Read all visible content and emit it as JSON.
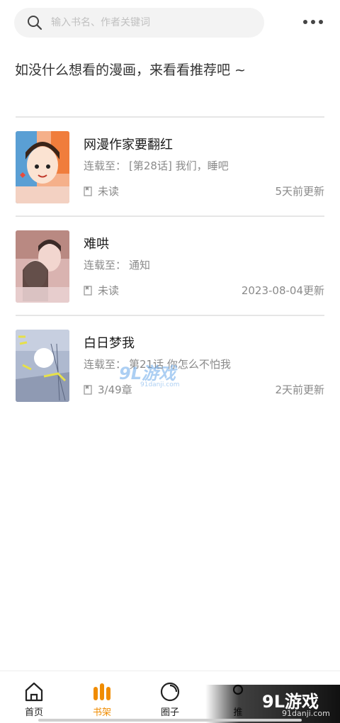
{
  "search": {
    "placeholder": "输入书名、作者关键词",
    "icon": "search-icon"
  },
  "header": {
    "more_icon": "more-dots-icon"
  },
  "prompt": "如没什么想看的漫画，来看看推荐吧 ~",
  "books": [
    {
      "title": "网漫作家要翻红",
      "update_prefix": "连载至：",
      "update_text": "[第28话] 我们，睡吧",
      "read_status": "未读",
      "updated_time": "5天前更新"
    },
    {
      "title": "难哄",
      "update_prefix": "连载至：",
      "update_text": "通知",
      "read_status": "未读",
      "updated_time": "2023-08-04更新"
    },
    {
      "title": "白日梦我",
      "update_prefix": "连载至：",
      "update_text": "第21话 你怎么不怕我",
      "read_status": "3/49章",
      "updated_time": "2天前更新"
    }
  ],
  "tabs": [
    {
      "label": "首页",
      "icon": "home-icon",
      "active": false
    },
    {
      "label": "书架",
      "icon": "bookshelf-icon",
      "active": true
    },
    {
      "label": "圈子",
      "icon": "circle-icon",
      "active": false
    },
    {
      "label": "推",
      "icon": "recommend-icon",
      "active": false
    }
  ],
  "colors": {
    "accent": "#f08c00",
    "text_primary": "#1a1a1a",
    "text_secondary": "#8a8a8a",
    "divider": "#e6e6e6",
    "search_bg": "#f3f3f3"
  },
  "watermark": {
    "center_big": "9L游戏",
    "center_small": "91danji.com",
    "corner_big": "9L游戏",
    "corner_small": "91danji.com"
  }
}
